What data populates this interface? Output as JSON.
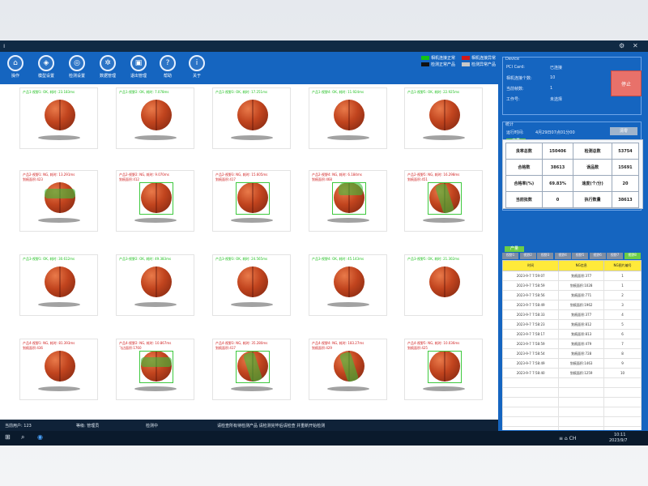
{
  "titlebar": {
    "left_glyph": "ı",
    "gear": "⚙",
    "close": "✕"
  },
  "toolbar": [
    {
      "label": "操作",
      "icon": "home-icon",
      "glyph": "⌂"
    },
    {
      "label": "模型设置",
      "icon": "model-icon",
      "glyph": "◈"
    },
    {
      "label": "检测设置",
      "icon": "detect-icon",
      "glyph": "◎"
    },
    {
      "label": "数据管理",
      "icon": "data-icon",
      "glyph": "✲"
    },
    {
      "label": "退出管理",
      "icon": "exit-icon",
      "glyph": "▣"
    },
    {
      "label": "帮助",
      "icon": "help-icon",
      "glyph": "?"
    },
    {
      "label": "关于",
      "icon": "info-icon",
      "glyph": "i"
    }
  ],
  "legend": [
    {
      "text": "相机连接正常",
      "color": "#14c214"
    },
    {
      "text": "相机连接异常",
      "color": "#d01818"
    },
    {
      "text": "检测正常产品",
      "color": "#111111"
    },
    {
      "text": "检测异常产品",
      "color": "#c8c8c8"
    }
  ],
  "images": [
    {
      "status": "ok",
      "label": "产品1-视野1: OK, 耗时: 23.183ms",
      "sub": "",
      "green": "",
      "box": false,
      "flat": false
    },
    {
      "status": "ok",
      "label": "产品1-视野2: OK, 耗时: 7.078ms",
      "sub": "",
      "green": "",
      "box": false,
      "flat": false
    },
    {
      "status": "ok",
      "label": "产品1-视野3: OK, 耗时: 17.251ms",
      "sub": "",
      "green": "",
      "box": false,
      "flat": false
    },
    {
      "status": "ok",
      "label": "产品1-视野4: OK, 耗时: 11.924ms",
      "sub": "",
      "green": "",
      "box": false,
      "flat": false
    },
    {
      "status": "ok",
      "label": "产品1-视野5: OK, 耗时: 22.925ms",
      "sub": "",
      "green": "",
      "box": false,
      "flat": false
    },
    {
      "status": "ng",
      "label": "产品2-视野1: NG, 耗时: 13.291ms",
      "sub": "划痕面积:423",
      "green": "band",
      "box": false,
      "flat": false
    },
    {
      "status": "ng",
      "label": "产品2-视野2: NG, 耗时: 9.070ms",
      "sub": "划痕面积:412",
      "green": "",
      "box": true,
      "flat": false
    },
    {
      "status": "ng",
      "label": "产品2-视野3: NG, 耗时: 15.605ms",
      "sub": "划痕面积:417",
      "green": "",
      "box": true,
      "flat": false
    },
    {
      "status": "ng",
      "label": "产品2-视野4: NG, 耗时: 6.184ms",
      "sub": "划痕面积:468",
      "green": "top",
      "box": true,
      "flat": false
    },
    {
      "status": "ng",
      "label": "产品2-视野5: NG, 耗时: 16.298ms",
      "sub": "划痕面积:451",
      "green": "diag",
      "box": true,
      "flat": false
    },
    {
      "status": "ok",
      "label": "产品3-视野1: OK, 耗时: 30.612ms",
      "sub": "",
      "green": "",
      "box": false,
      "flat": false
    },
    {
      "status": "ok",
      "label": "产品3-视野2: OK, 耗时: 49.383ms",
      "sub": "",
      "green": "",
      "box": false,
      "flat": false
    },
    {
      "status": "ok",
      "label": "产品3-视野3: OK, 耗时: 24.565ms",
      "sub": "",
      "green": "",
      "box": false,
      "flat": false
    },
    {
      "status": "ok",
      "label": "产品3-视野4: OK, 耗时: 45.143ms",
      "sub": "",
      "green": "",
      "box": false,
      "flat": false
    },
    {
      "status": "ok",
      "label": "产品3-视野5: OK, 耗时: 21.302ms",
      "sub": "",
      "green": "",
      "box": false,
      "flat": true
    },
    {
      "status": "ng",
      "label": "产品4-视野1: NG, 耗时: 81.393ms",
      "sub": "划痕面积:436",
      "green": "",
      "box": false,
      "flat": false
    },
    {
      "status": "ng",
      "label": "产品4-视野2: NG, 耗时: 10.867ms",
      "sub": "飞边面积:1760",
      "green": "band",
      "box": true,
      "flat": false
    },
    {
      "status": "ng",
      "label": "产品4-视野3: NG, 耗时: 35.280ms",
      "sub": "划痕面积:417",
      "green": "diag",
      "box": true,
      "flat": false
    },
    {
      "status": "ng",
      "label": "产品4-视野4: NG, 耗时: 183.27ms",
      "sub": "划痕面积:429",
      "green": "diag",
      "box": false,
      "flat": false
    },
    {
      "status": "ng",
      "label": "产品4-视野5: NG, 耗时: 10.036ms",
      "sub": "划痕面积:425",
      "green": "",
      "box": true,
      "flat": false
    }
  ],
  "statusbar": {
    "user": "当前用户: 123",
    "role": "等级: 管理员",
    "detect": "检测中",
    "tips": "请检查所有待检测产品   请检测完毕后请检查   并重新开始检测"
  },
  "device": {
    "title": "Device",
    "rows": [
      {
        "k": "PCI Card:",
        "v": "已连接"
      },
      {
        "k": "相机连接个数:",
        "v": "10"
      },
      {
        "k": "当前帧数:",
        "v": "1"
      },
      {
        "k": "工作号:",
        "v": "未选择"
      }
    ],
    "stop_label": "停止"
  },
  "stats_panel": {
    "title": "统计",
    "reset_time_label": "运行时间:",
    "reset_time": "4月29日07点01分00",
    "reset_button": "清零",
    "tab_label": "产量",
    "table": [
      [
        "良率总数",
        "150406",
        "检测总数",
        "53754"
      ],
      [
        "合格数",
        "38613",
        "误品数",
        "15691"
      ],
      [
        "合格率(%)",
        "69.83%",
        "速度(个/分)",
        "20"
      ],
      [
        "当前批数",
        "0",
        "执行数量",
        "38613"
      ]
    ]
  },
  "log": {
    "tabs": [
      "视野1",
      "视野2",
      "视野3",
      "视野4",
      "视野5",
      "视野6",
      "视野7",
      "视野8"
    ],
    "active_tab": 7,
    "headers": [
      "时间",
      "NG信息",
      "NG图片编号"
    ],
    "rows": [
      [
        "2023-9-7 7:59:07",
        "划痕面积:377",
        "1"
      ],
      [
        "2023-9-7 7:58:59",
        "划痕面积:1028",
        "1"
      ],
      [
        "2023-9-7 7:58:56",
        "划痕面积:771",
        "2"
      ],
      [
        "2023-9-7 7:58:49",
        "划痕面积:1962",
        "3"
      ],
      [
        "2023-9-7 7:58:33",
        "划痕面积:377",
        "4"
      ],
      [
        "2023-9-7 7:58:23",
        "划痕面积:812",
        "5"
      ],
      [
        "2023-9-7 7:58:17",
        "划痕面积:813",
        "6"
      ],
      [
        "2023-9-7 7:58:59",
        "划痕面积:479",
        "7"
      ],
      [
        "2023-9-7 7:58:54",
        "划痕面积:728",
        "8"
      ],
      [
        "2023-9-7 7:58:49",
        "划痕面积:1463",
        "9"
      ],
      [
        "2023-9-7 7:58:40",
        "划痕面积:1259",
        "10"
      ]
    ]
  },
  "taskbar": {
    "time": "10:11",
    "date": "2023/9/7",
    "tray": "≡  ⌂  CH"
  }
}
